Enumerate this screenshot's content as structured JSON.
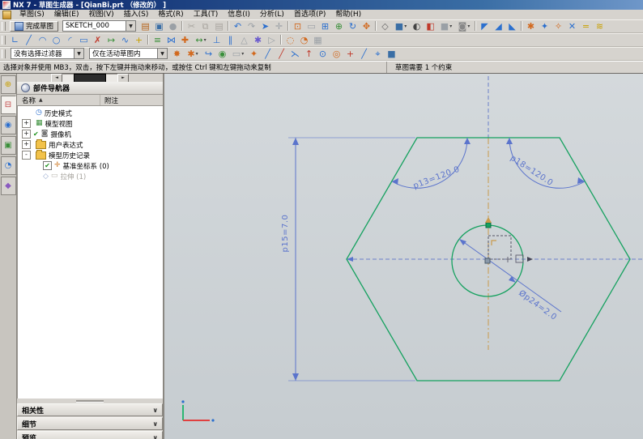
{
  "theme": {
    "chrome": "#d6d3ce",
    "title1": "#0a246a",
    "title2": "#3a6ea5",
    "green": "#15a15f",
    "dim": "#5b74cc",
    "dimdash": "#6b80c9",
    "tan": "#c99a4b",
    "vpbg1": "#d4d9dc",
    "vpbg2": "#c6ccd0"
  },
  "window": {
    "title": "NX 7 - 草图生成器 - [QianBi.prt （修改的） ]"
  },
  "menu": {
    "items": [
      {
        "n": "menu-sketch",
        "label": "草图(S)"
      },
      {
        "n": "menu-edit",
        "label": "编辑(E)"
      },
      {
        "n": "menu-view",
        "label": "视图(V)"
      },
      {
        "n": "menu-insert",
        "label": "插入(S)"
      },
      {
        "n": "menu-format",
        "label": "格式(R)"
      },
      {
        "n": "menu-tools",
        "label": "工具(T)"
      },
      {
        "n": "menu-info",
        "label": "信息(I)"
      },
      {
        "n": "menu-analysis",
        "label": "分析(L)"
      },
      {
        "n": "menu-preferences",
        "label": "首选项(P)"
      },
      {
        "n": "menu-help",
        "label": "帮助(H)"
      }
    ]
  },
  "toolbar1": {
    "finish": "完成草图",
    "sketch_name": "SKETCH_000",
    "icons": [
      {
        "n": "sketch-style-icon",
        "g": "▤",
        "c": "#b5651d"
      },
      {
        "n": "open-file-icon",
        "g": "▣",
        "c": "#3a6ea5"
      },
      {
        "n": "display-part-icon",
        "g": "●",
        "c": "#9aa0a6"
      },
      {
        "sep": 1
      },
      {
        "n": "cut-icon",
        "g": "✂",
        "c": "#a9a6a0"
      },
      {
        "n": "copy-icon",
        "g": "⧉",
        "c": "#a9a6a0"
      },
      {
        "n": "paste-icon",
        "g": "▤",
        "c": "#a9a6a0"
      },
      {
        "sep": 1
      },
      {
        "n": "undo-icon",
        "g": "↶",
        "c": "#2b6fce"
      },
      {
        "n": "redo-icon",
        "g": "↷",
        "c": "#9aa0a6"
      },
      {
        "n": "selection-icon",
        "g": "➤",
        "c": "#2b6fce"
      },
      {
        "n": "touch-mode-icon",
        "g": "✛",
        "c": "#9aa0a6"
      },
      {
        "sep": 1
      },
      {
        "n": "fit-view-icon",
        "g": "⊡",
        "c": "#d2691e"
      },
      {
        "n": "zoom-icon",
        "g": "▭",
        "c": "#9aa0a6"
      },
      {
        "n": "zoom-window-icon",
        "g": "⊞",
        "c": "#2b6fce"
      },
      {
        "n": "magnify-icon",
        "g": "⊕",
        "c": "#3a8f3a"
      },
      {
        "n": "rotate-view-icon",
        "g": "↻",
        "c": "#2b6fce"
      },
      {
        "n": "pan-view-icon",
        "g": "✥",
        "c": "#d2691e"
      },
      {
        "sep": 1
      },
      {
        "n": "wireframe-icon",
        "g": "◇",
        "c": "#666666"
      },
      {
        "n": "shaded-icon",
        "g": "■",
        "c": "#3a6ea5",
        "dd": 1
      },
      {
        "n": "render-style-icon",
        "g": "◐",
        "c": "#444444"
      },
      {
        "n": "section-icon",
        "g": "◧",
        "c": "#c0392b"
      },
      {
        "n": "view-cube-icon",
        "g": "■",
        "c": "#9aa0a6",
        "dd": 1
      },
      {
        "n": "face-view-icon",
        "g": "◙",
        "c": "#888888",
        "dd": 1
      },
      {
        "sep": 1
      },
      {
        "n": "orient-view-top-icon",
        "g": "◤",
        "c": "#2b6fce"
      },
      {
        "n": "orient-view-front-icon",
        "g": "◢",
        "c": "#2b6fce"
      },
      {
        "n": "orient-view-iso-icon",
        "g": "◣",
        "c": "#2b6fce"
      },
      {
        "sep": 1
      },
      {
        "n": "snap-settings-icon",
        "g": "✱",
        "c": "#d2691e"
      },
      {
        "n": "work-plane-icon",
        "g": "✦",
        "c": "#2b6fce"
      },
      {
        "n": "grid-icon",
        "g": "✧",
        "c": "#d2691e"
      },
      {
        "n": "crosshair-icon",
        "g": "✕",
        "c": "#2b6fce"
      },
      {
        "n": "measure-icon",
        "g": "=",
        "c": "#c8a000"
      },
      {
        "n": "hatch-icon",
        "g": "≋",
        "c": "#c8a000"
      }
    ]
  },
  "toolbar2": {
    "icons": [
      {
        "n": "profile-icon",
        "g": "∟",
        "c": "#2b6fce"
      },
      {
        "n": "line-icon",
        "g": "╱",
        "c": "#2b6fce"
      },
      {
        "n": "arc-icon",
        "g": "◠",
        "c": "#2b6fce"
      },
      {
        "n": "circle-icon",
        "g": "○",
        "c": "#2b6fce"
      },
      {
        "n": "fillet-icon",
        "g": "◜",
        "c": "#2b6fce"
      },
      {
        "n": "rectangle-icon",
        "g": "▭",
        "c": "#2b6fce"
      },
      {
        "n": "quick-trim-icon",
        "g": "✗",
        "c": "#c0392b"
      },
      {
        "n": "quick-extend-icon",
        "g": "↦",
        "c": "#3a8f3a"
      },
      {
        "n": "studio-spline-icon",
        "g": "∿",
        "c": "#2b6fce"
      },
      {
        "n": "point-icon",
        "g": "+",
        "c": "#c8a000"
      },
      {
        "sep": 1
      },
      {
        "n": "offset-curve-icon",
        "g": "≡",
        "c": "#3a8f3a"
      },
      {
        "n": "mirror-curve-icon",
        "g": "⋈",
        "c": "#2b6fce"
      },
      {
        "n": "intersection-point-icon",
        "g": "✚",
        "c": "#d2691e"
      },
      {
        "n": "inferred-dimension-icon",
        "g": "↔",
        "c": "#3a8f3a",
        "dd": 1
      },
      {
        "n": "constraints-icon",
        "g": "⊥",
        "c": "#2b6fce"
      },
      {
        "n": "make-symmetric-icon",
        "g": "∥",
        "c": "#2b6fce"
      },
      {
        "n": "show-constraints-icon",
        "g": "△",
        "c": "#9aa0a6"
      },
      {
        "n": "auto-constrain-icon",
        "g": "✱",
        "c": "#6a5acd"
      },
      {
        "n": "animate-dimension-icon",
        "g": "▷",
        "c": "#9aa0a6"
      },
      {
        "sep": 1
      },
      {
        "n": "convert-reference-icon",
        "g": "◌",
        "c": "#d2691e"
      },
      {
        "n": "alternate-solution-icon",
        "g": "◔",
        "c": "#d2691e"
      },
      {
        "n": "relations-browser-icon",
        "g": "▦",
        "c": "#9aa0a6"
      }
    ]
  },
  "toolbar3": {
    "filter": "没有选择过滤器",
    "scope": "仅在活动草图内",
    "icons": [
      {
        "n": "snap-point-enable-icon",
        "g": "✸",
        "c": "#d2691e"
      },
      {
        "n": "snap-point-options-icon",
        "g": "✱",
        "c": "#d2691e",
        "dd": 1
      },
      {
        "n": "reattach-icon",
        "g": "↪",
        "c": "#2b6fce"
      },
      {
        "n": "orient-to-sketch-icon",
        "g": "◉",
        "c": "#3a8f3a"
      },
      {
        "n": "delayed-evaluation-icon",
        "g": "▭",
        "c": "#9aa0a6",
        "dd": 1
      },
      {
        "n": "end-point-icon",
        "g": "✦",
        "c": "#d2691e"
      },
      {
        "n": "mid-point-icon",
        "g": "╱",
        "c": "#2b6fce"
      },
      {
        "n": "control-point-icon",
        "g": "╱",
        "c": "#c0392b"
      },
      {
        "n": "intersection-snap-icon",
        "g": "⋋",
        "c": "#2b6fce"
      },
      {
        "n": "arc-center-icon",
        "g": "↑",
        "c": "#c0392b"
      },
      {
        "n": "quadrant-point-icon",
        "g": "⊙",
        "c": "#2b6fce"
      },
      {
        "n": "existing-point-icon",
        "g": "◎",
        "c": "#d2691e"
      },
      {
        "n": "point-on-curve-icon",
        "g": "+",
        "c": "#c0392b"
      },
      {
        "n": "point-on-line-icon",
        "g": "╱",
        "c": "#2b6fce"
      },
      {
        "n": "cursor-location-icon",
        "g": "⌖",
        "c": "#2b6fce"
      },
      {
        "n": "shaded-work-icon",
        "g": "■",
        "c": "#3a6ea5"
      }
    ]
  },
  "status": {
    "prompt": "选择对象并使用 MB3，双击，按下左键并拖动来移动，或按住 Ctrl 键和左键拖动来复制",
    "constraint": "草图需要 1 个约束"
  },
  "resbar": {
    "tabs": [
      {
        "n": "assembly-navigator-tab",
        "g": "⊕",
        "c": "#c8a000"
      },
      {
        "n": "part-navigator-tab",
        "g": "⊟",
        "c": "#c04040",
        "active": 1
      },
      {
        "n": "web-browser-tab",
        "g": "◉",
        "c": "#2b6fce"
      },
      {
        "n": "history-palette-tab",
        "g": "▣",
        "c": "#3a8f3a"
      },
      {
        "n": "system-materials-tab",
        "g": "◔",
        "c": "#2b6fce"
      },
      {
        "n": "roles-tab",
        "g": "◆",
        "c": "#8a5ac0"
      }
    ]
  },
  "navigator": {
    "title": "部件导航器",
    "col_name": "名称",
    "sort": "▲",
    "col_note": "附注",
    "tree": [
      {
        "n": "tree-history-mode",
        "icon": "clock",
        "label": "历史模式"
      },
      {
        "n": "tree-model-views",
        "expand": "+",
        "icon": "views",
        "label": "模型视图"
      },
      {
        "n": "tree-cameras",
        "expand": "+",
        "check": "check",
        "icon": "camera",
        "label": "摄像机"
      },
      {
        "n": "tree-user-expressions",
        "expand": "+",
        "icon": "folder",
        "label": "用户表达式"
      },
      {
        "n": "tree-model-history",
        "expand": "-",
        "icon": "folder",
        "label": "模型历史记录"
      },
      {
        "n": "tree-datum-csys",
        "indent": 1,
        "check": "box",
        "icon": "csys",
        "label": "基准坐标系 (0)"
      },
      {
        "n": "tree-extrude",
        "indent": 1,
        "check": "diamond",
        "icon": "extrude",
        "label": "拉伸 (1)",
        "grayed": 1
      }
    ],
    "sections": [
      {
        "n": "section-dependencies",
        "label": "相关性"
      },
      {
        "n": "section-details",
        "label": "细节"
      },
      {
        "n": "section-preview",
        "label": "预览"
      }
    ]
  },
  "viewport": {
    "dims": {
      "angle_left": "p13=120.0",
      "angle_right": "p18=120.0",
      "height": "p15=7.0",
      "diameter": "Øp24=2.0"
    }
  }
}
